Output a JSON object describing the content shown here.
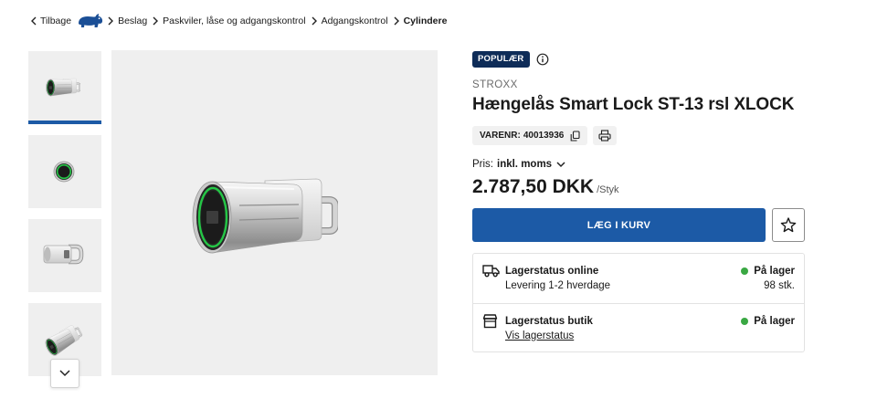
{
  "breadcrumb": {
    "back_label": "Tilbage",
    "items": [
      "Beslag",
      "Paskviler, låse og adgangskontrol",
      "Adgangskontrol"
    ],
    "current": "Cylindere"
  },
  "gallery": {
    "selected_thumbnail_index": 0
  },
  "product": {
    "badge": "POPULÆR",
    "brand": "STROXX",
    "title": "Hængelås Smart Lock ST-13 rsl XLOCK",
    "sku_label": "VARENR:",
    "sku_value": "40013936",
    "price_mode_label": "Pris:",
    "price_mode_value": "inkl. moms",
    "price": "2.787,50 DKK",
    "price_unit": "/Styk",
    "add_to_cart_label": "LÆG I KURV"
  },
  "stock": {
    "online": {
      "title": "Lagerstatus online",
      "detail": "Levering 1-2 hverdage",
      "status": "På lager",
      "quantity": "98 stk."
    },
    "store": {
      "title": "Lagerstatus butik",
      "link": "Vis lagerstatus",
      "status": "På lager"
    }
  },
  "icons": {
    "back": "chevron-left-icon",
    "separator": "chevron-right-icon",
    "logo": "brand-logo",
    "gallery_next": "chevron-down-icon",
    "info": "info-icon",
    "copy": "copy-icon",
    "print": "printer-icon",
    "price_toggle": "chevron-down-icon",
    "wishlist": "star-icon",
    "online_stock": "truck-icon",
    "store_stock": "store-icon",
    "stock_status": "dot-icon"
  },
  "colors": {
    "accent": "#1c5aa6",
    "badge": "#0e2c58",
    "in_stock": "#3aa843",
    "text": "#1a1a1a",
    "muted": "#6b6b6b",
    "image_bg": "#efefef",
    "logo": "#1b4f96"
  }
}
